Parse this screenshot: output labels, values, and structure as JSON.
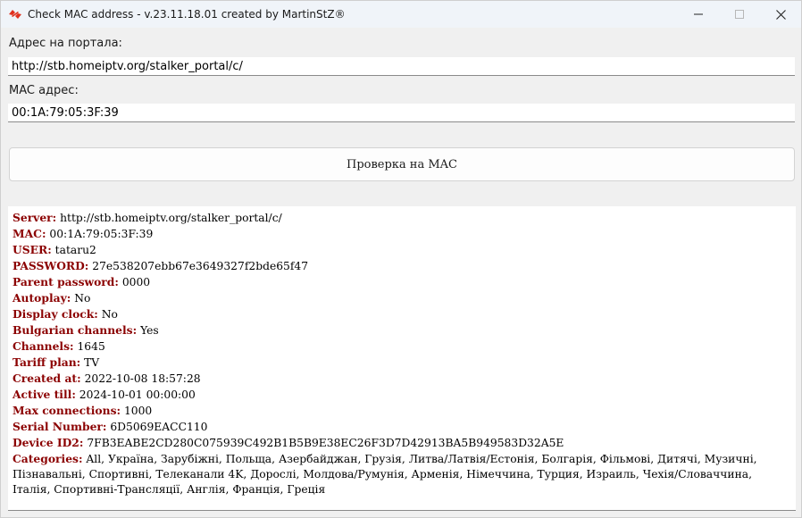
{
  "window": {
    "title": "Check MAC address - v.23.11.18.01 created by MartinStZ®",
    "minimize_glyph": "—",
    "maximize_glyph": "☐",
    "close_glyph": "✕"
  },
  "form": {
    "portal_label": "Адрес на портала:",
    "portal_value": "http://stb.homeiptv.org/stalker_portal/c/",
    "mac_label": "MAC адрес:",
    "mac_value": "00:1A:79:05:3F:39",
    "check_button": "Проверка на MAC"
  },
  "result": [
    {
      "key": "Server:",
      "value": "http://stb.homeiptv.org/stalker_portal/c/"
    },
    {
      "key": "MAC:",
      "value": "00:1A:79:05:3F:39"
    },
    {
      "key": "USER:",
      "value": "tataru2"
    },
    {
      "key": "PASSWORD:",
      "value": "27e538207ebb67e3649327f2bde65f47"
    },
    {
      "key": "Parent password:",
      "value": "0000"
    },
    {
      "key": "Autoplay:",
      "value": "No"
    },
    {
      "key": "Display clock:",
      "value": "No"
    },
    {
      "key": "Bulgarian channels:",
      "value": "Yes"
    },
    {
      "key": "Channels:",
      "value": "1645"
    },
    {
      "key": "Tariff plan:",
      "value": "TV"
    },
    {
      "key": "Created at:",
      "value": "2022-10-08 18:57:28"
    },
    {
      "key": "Active till:",
      "value": "2024-10-01 00:00:00"
    },
    {
      "key": "Max connections:",
      "value": "1000"
    },
    {
      "key": "Serial Number:",
      "value": "6D5069EACC110"
    },
    {
      "key": "Device ID2:",
      "value": "7FB3EABE2CD280C075939C492B1B5B9E38EC26F3D7D42913BA5B949583D32A5E"
    },
    {
      "key": "Categories:",
      "value": "All, Україна, Зарубіжні, Польща, Азербайджан, Грузія, Литва/Латвія/Естонія, Болгарія, Фільмові, Дитячі, Музичні, Пізнавальні, Спортивні, Телеканали 4K, Дорослі, Молдова/Румунія, Арменія, Німеччина, Турция, Израиль, Чехія/Словаччина, Італія, Спортивні-Трансляції, Англія, Франція, Греція"
    }
  ],
  "colors": {
    "key_text": "#8b0000",
    "titlebar": "#f0f4f9",
    "window_bg": "#f0f0f0"
  },
  "icons": {
    "app": "app-logo-icon",
    "minimize": "minimize-icon",
    "maximize": "maximize-icon",
    "close": "close-icon"
  }
}
